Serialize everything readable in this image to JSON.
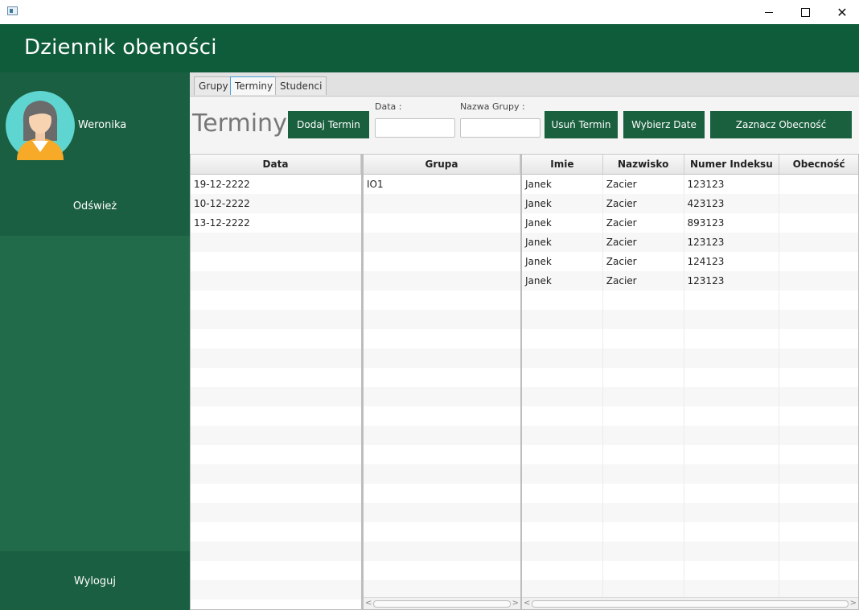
{
  "window": {
    "app_title": "Dziennik obeności"
  },
  "sidebar": {
    "username": "Weronika",
    "refresh_label": "Odśwież",
    "logout_label": "Wyloguj"
  },
  "tabs": [
    {
      "label": "Grupy"
    },
    {
      "label": "Terminy",
      "active": true
    },
    {
      "label": "Studenci"
    }
  ],
  "toolbar": {
    "section_title": "Terminy",
    "add_term_label": "Dodaj Termin",
    "date_label": "Data :",
    "date_value": "",
    "group_name_label": "Nazwa Grupy :",
    "group_name_value": "",
    "delete_term_label": "Usuń Termin",
    "choose_date_label": "Wybierz Date",
    "mark_attendance_label": "Zaznacz Obecność"
  },
  "dates_table": {
    "header": "Data",
    "rows": [
      "19-12-2222",
      "10-12-2222",
      "13-12-2222"
    ]
  },
  "groups_table": {
    "header": "Grupa",
    "rows": [
      "IO1"
    ]
  },
  "students_table": {
    "headers": [
      "Imie",
      "Nazwisko",
      "Numer Indeksu",
      "Obecność"
    ],
    "rows": [
      [
        "Janek",
        "Zacier",
        "123123",
        ""
      ],
      [
        "Janek",
        "Zacier",
        "423123",
        ""
      ],
      [
        "Janek",
        "Zacier",
        "893123",
        ""
      ],
      [
        "Janek",
        "Zacier",
        "123123",
        ""
      ],
      [
        "Janek",
        "Zacier",
        "124123",
        ""
      ],
      [
        "Janek",
        "Zacier",
        "123123",
        ""
      ]
    ]
  },
  "colors": {
    "header_green": "#0f5c3a",
    "sidebar_green": "#216b4b",
    "button_green": "#1a5f3e"
  }
}
